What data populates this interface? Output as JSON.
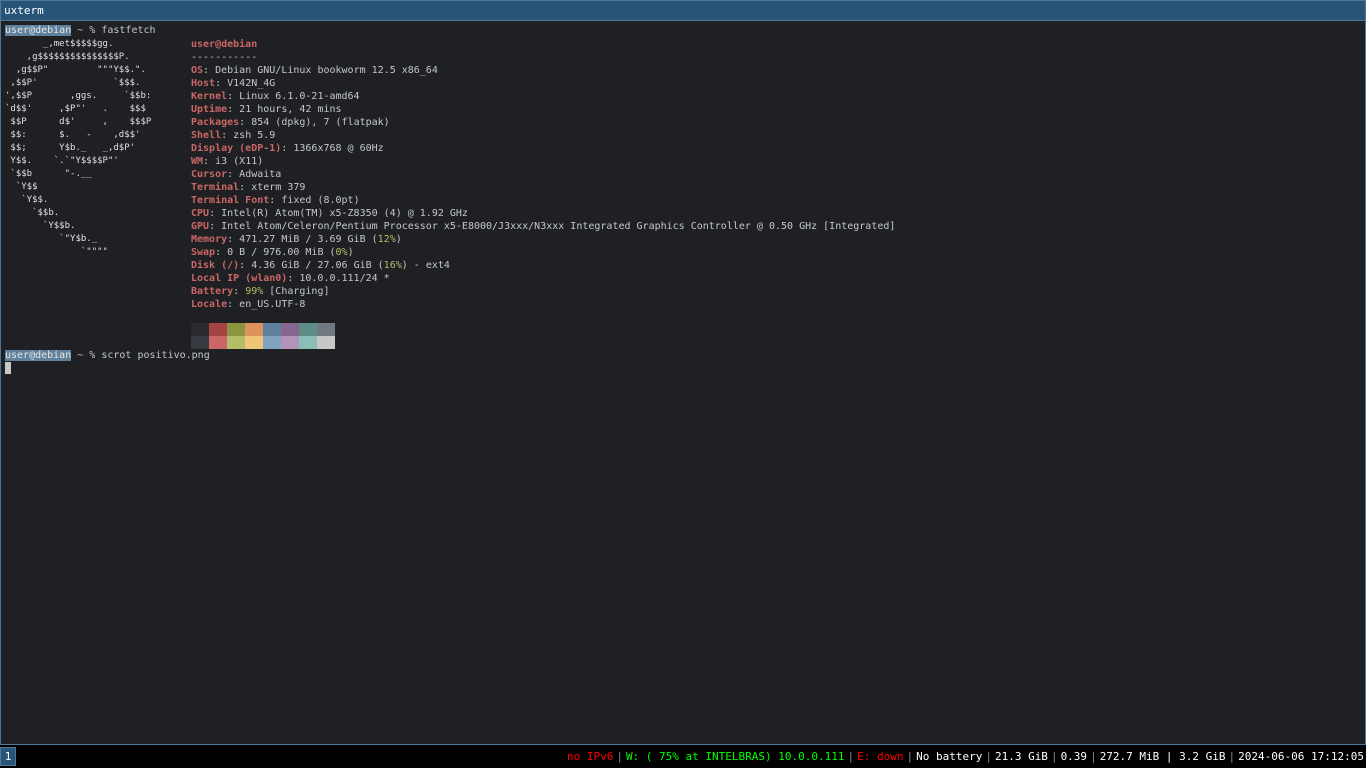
{
  "window": {
    "title": "uxterm"
  },
  "prompt1": {
    "user": "user@debian",
    "rest": " ~ % ",
    "command": "fastfetch"
  },
  "prompt2": {
    "user": "user@debian",
    "rest": " ~ % ",
    "command": "scrot positivo.png"
  },
  "ascii_logo": "       _,met$$$$$gg.\n    ,g$$$$$$$$$$$$$$$P.\n  ,g$$P\"         \"\"\"Y$$.\".\n ,$$P'              `$$$.\n',$$P       ,ggs.     `$$b:\n`d$$'     ,$P\"'   .    $$$\n $$P      d$'     ,    $$$P\n $$:      $.   -    ,d$$'\n $$;      Y$b._   _,d$P'\n Y$$.    `.`\"Y$$$$P\"'\n `$$b      \"-.__\n  `Y$$\n   `Y$$.\n     `$$b.\n       `Y$$b.\n          `\"Y$b._\n              `\"\"\"\"",
  "fastfetch": {
    "header": "user@debian",
    "separator": "-----------",
    "rows": [
      {
        "key": "OS",
        "value": "Debian GNU/Linux bookworm 12.5 x86_64"
      },
      {
        "key": "Host",
        "value": "V142N_4G"
      },
      {
        "key": "Kernel",
        "value": "Linux 6.1.0-21-amd64"
      },
      {
        "key": "Uptime",
        "value": "21 hours, 42 mins"
      },
      {
        "key": "Packages",
        "value": "854 (dpkg), 7 (flatpak)"
      },
      {
        "key": "Shell",
        "value": "zsh 5.9"
      },
      {
        "key": "Display (eDP-1)",
        "value": "1366x768 @ 60Hz"
      },
      {
        "key": "WM",
        "value": "i3 (X11)"
      },
      {
        "key": "Cursor",
        "value": "Adwaita"
      },
      {
        "key": "Terminal",
        "value": "xterm 379"
      },
      {
        "key": "Terminal Font",
        "value": "fixed (8.0pt)"
      },
      {
        "key": "CPU",
        "value": "Intel(R) Atom(TM) x5-Z8350 (4) @ 1.92 GHz"
      },
      {
        "key": "GPU",
        "value": "Intel Atom/Celeron/Pentium Processor x5-E8000/J3xxx/N3xxx Integrated Graphics Controller @ 0.50 GHz [Integrated]"
      },
      {
        "key": "Memory",
        "value_pre": "471.27 MiB / 3.69 GiB (",
        "value_hl": "12%",
        "value_post": ")"
      },
      {
        "key": "Swap",
        "value_pre": "0 B / 976.00 MiB (",
        "value_hl": "0%",
        "value_post": ")"
      },
      {
        "key": "Disk (/)",
        "value_pre": "4.36 GiB / 27.06 GiB (",
        "value_hl": "16%",
        "value_post": ") - ext4"
      },
      {
        "key": "Local IP (wlan0)",
        "value": "10.0.0.111/24 *"
      },
      {
        "key": "Battery",
        "value_pre": "",
        "value_hl": "99%",
        "value_post": " [Charging]"
      },
      {
        "key": "Locale",
        "value": "en_US.UTF-8"
      }
    ]
  },
  "palette": {
    "normal": [
      "#282a2e",
      "#a54242",
      "#8c9440",
      "#de935f",
      "#5f819d",
      "#85678f",
      "#5e8d87",
      "#707880"
    ],
    "bright": [
      "#373b41",
      "#cc6666",
      "#b5bd68",
      "#f0c674",
      "#81a2be",
      "#b294bb",
      "#8abeb7",
      "#c5c8c6"
    ]
  },
  "i3bar": {
    "workspace": "1",
    "blocks": [
      {
        "text": "no IPv6",
        "color": "#ff0000"
      },
      {
        "text": "W: ( 75% at INTELBRAS) 10.0.0.111",
        "color": "#00ff00"
      },
      {
        "text": "E: down",
        "color": "#ff0000"
      },
      {
        "text": "No battery",
        "color": "#ffffff"
      },
      {
        "text": "21.3 GiB",
        "color": "#ffffff"
      },
      {
        "text": "0.39",
        "color": "#ffffff"
      },
      {
        "text": "272.7 MiB | 3.2 GiB",
        "color": "#ffffff"
      },
      {
        "text": "2024-06-06 17:12:05",
        "color": "#ffffff"
      }
    ]
  }
}
